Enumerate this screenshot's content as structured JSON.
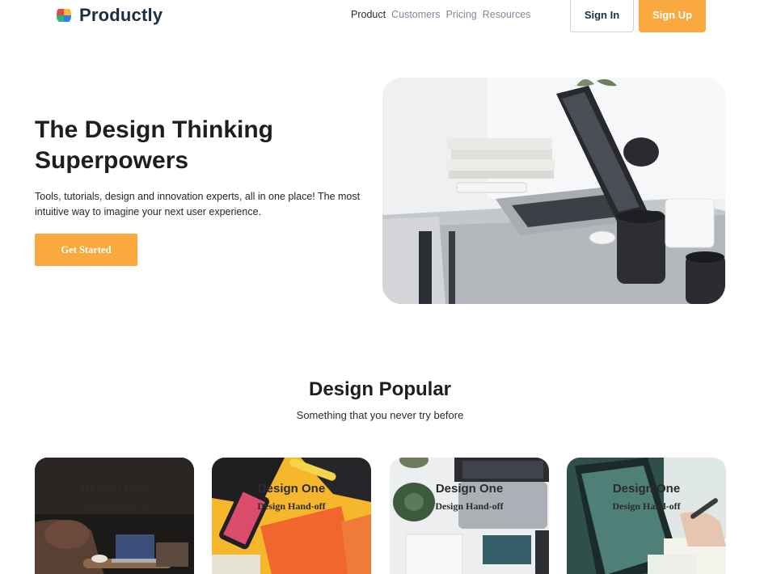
{
  "brand": {
    "name": "Productly"
  },
  "nav": {
    "items": [
      {
        "label": "Product",
        "active": true
      },
      {
        "label": "Customers",
        "active": false
      },
      {
        "label": "Pricing",
        "active": false
      },
      {
        "label": "Resources",
        "active": false
      }
    ],
    "signin_label": "Sign In",
    "signup_label": "Sign Up"
  },
  "hero": {
    "title_line1": "The Design Thinking",
    "title_line2": "Superpowers",
    "description": "Tools, tutorials, design and innovation experts, all in one place! The most intuitive way to imagine your next user experience.",
    "cta_label": "Get Started",
    "image_icon": "laptop-desk-photo"
  },
  "popular": {
    "title": "Design Popular",
    "subtitle": "Something that you never try before",
    "cards": [
      {
        "title": "Design One",
        "subtitle": "Design Hand-off",
        "image_icon": "living-room-laptop-photo"
      },
      {
        "title": "Design One",
        "subtitle": "Design Hand-off",
        "image_icon": "yellow-desk-phone-book-photo"
      },
      {
        "title": "Design One",
        "subtitle": "Design Hand-off",
        "image_icon": "keyboard-plant-notebook-photo"
      },
      {
        "title": "Design One",
        "subtitle": "Design Hand-off",
        "image_icon": "tablet-sketching-photo"
      }
    ]
  },
  "colors": {
    "accent": "#f9a940",
    "brand_text": "#1c2d45",
    "nav_muted": "#7e8b99"
  }
}
